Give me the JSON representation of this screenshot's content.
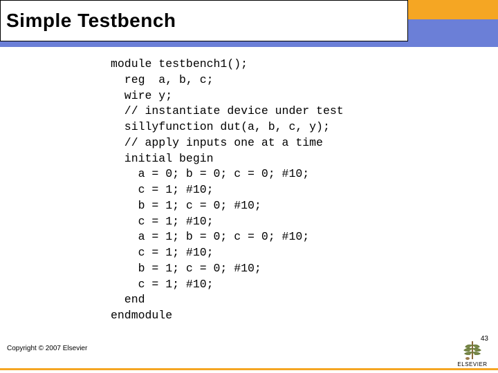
{
  "header": {
    "title": "Simple Testbench"
  },
  "code": {
    "lines": [
      "module testbench1();",
      "  reg  a, b, c;",
      "  wire y;",
      "  // instantiate device under test",
      "  sillyfunction dut(a, b, c, y);",
      "  // apply inputs one at a time",
      "  initial begin",
      "    a = 0; b = 0; c = 0; #10;",
      "    c = 1; #10;",
      "    b = 1; c = 0; #10;",
      "    c = 1; #10;",
      "    a = 1; b = 0; c = 0; #10;",
      "    c = 1; #10;",
      "    b = 1; c = 0; #10;",
      "    c = 1; #10;",
      "  end",
      "endmodule"
    ]
  },
  "footer": {
    "copyright": "Copyright © 2007 Elsevier",
    "page_number": "43",
    "logo_text": "ELSEVIER"
  }
}
